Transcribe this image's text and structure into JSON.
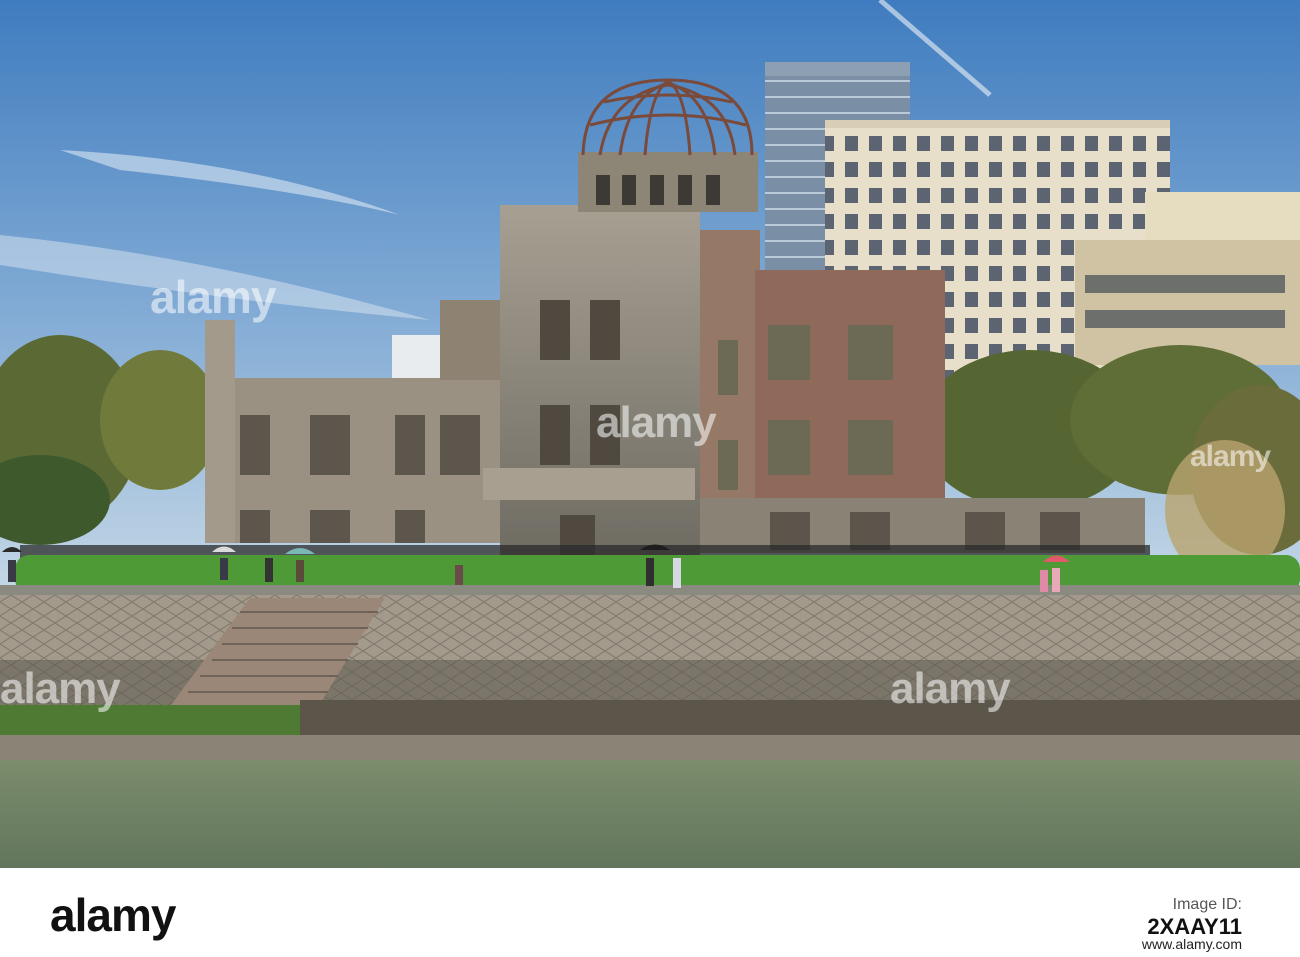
{
  "scene": {
    "subject": "Atomic Bomb Dome",
    "colors": {
      "sky_top": "#4d86c2",
      "sky_bottom": "#b7cfe2",
      "ruin_stone": "#9b8f80",
      "brick": "#8f6a5a",
      "hedge": "#4b9a36",
      "water": "#6f8466"
    }
  },
  "watermarks": {
    "center_logo": "alamy",
    "mid_left": "alamy",
    "mid_right": "alamy",
    "low_left": "alamy",
    "low_right": "alamy"
  },
  "footer": {
    "brand": "alamy",
    "image_id_label": "Image ID:",
    "image_id": "2XAAY11",
    "website": "www.alamy.com"
  }
}
